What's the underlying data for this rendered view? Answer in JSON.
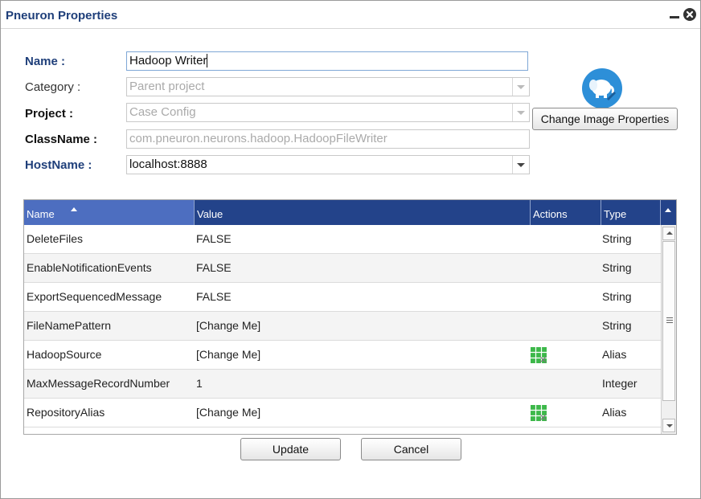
{
  "dialog": {
    "title": "Pneuron Properties"
  },
  "form": {
    "name_label": "Name :",
    "name_value": "Hadoop Writer",
    "category_label": "Category :",
    "category_value": "Parent project",
    "project_label": "Project :",
    "project_value": "Case Config",
    "classname_label": "ClassName :",
    "classname_value": "com.pneuron.neurons.hadoop.HadoopFileWriter",
    "hostname_label": "HostName :",
    "hostname_value": "localhost:8888",
    "change_image_label": "Change Image Properties"
  },
  "grid": {
    "columns": [
      "Name",
      "Value",
      "Actions",
      "Type"
    ],
    "sorted_column": "Name",
    "sort_direction": "ascending",
    "rows": [
      {
        "name": "DeleteFiles",
        "value": "FALSE",
        "action_icon": "",
        "type": "String"
      },
      {
        "name": "EnableNotificationEvents",
        "value": "FALSE",
        "action_icon": "",
        "type": "String"
      },
      {
        "name": "ExportSequencedMessage",
        "value": "FALSE",
        "action_icon": "",
        "type": "String"
      },
      {
        "name": "FileNamePattern",
        "value": "[Change Me]",
        "action_icon": "",
        "type": "String"
      },
      {
        "name": "HadoopSource",
        "value": "[Change Me]",
        "action_icon": "alias-grid-icon",
        "type": "Alias"
      },
      {
        "name": "MaxMessageRecordNumber",
        "value": "1",
        "action_icon": "",
        "type": "Integer"
      },
      {
        "name": "RepositoryAlias",
        "value": "[Change Me]",
        "action_icon": "alias-grid-icon",
        "type": "Alias"
      }
    ]
  },
  "footer": {
    "update_label": "Update",
    "cancel_label": "Cancel"
  },
  "colors": {
    "header_bg": "#23438a",
    "sorted_header_bg": "#4d6ec0",
    "label_blue": "#1f3f7a",
    "image_icon_bg": "#2d8fd8",
    "alias_icon": "#3db84a"
  }
}
